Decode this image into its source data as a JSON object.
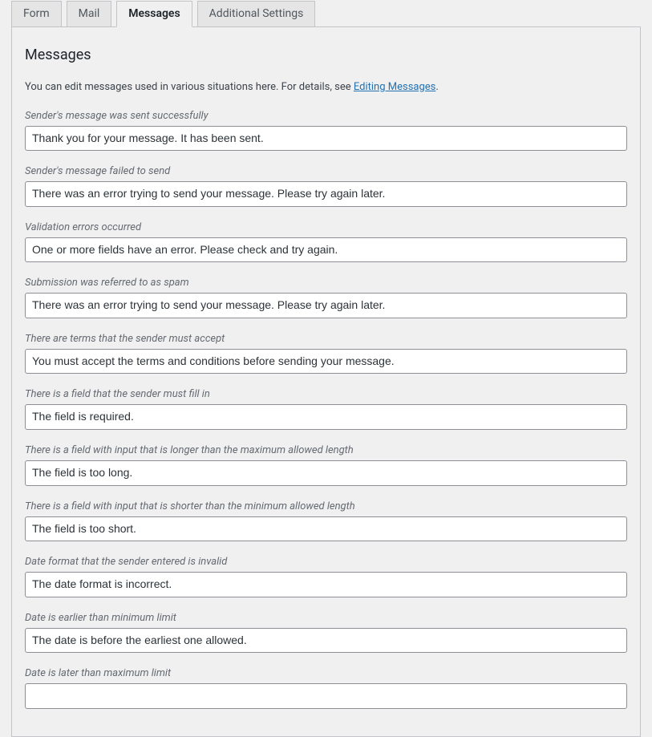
{
  "tabs": [
    {
      "label": "Form",
      "active": false
    },
    {
      "label": "Mail",
      "active": false
    },
    {
      "label": "Messages",
      "active": true
    },
    {
      "label": "Additional Settings",
      "active": false
    }
  ],
  "panel": {
    "title": "Messages",
    "intro_prefix": "You can edit messages used in various situations here. For details, see ",
    "intro_link": "Editing Messages",
    "intro_suffix": "."
  },
  "fields": [
    {
      "label": "Sender's message was sent successfully",
      "value": "Thank you for your message. It has been sent."
    },
    {
      "label": "Sender's message failed to send",
      "value": "There was an error trying to send your message. Please try again later."
    },
    {
      "label": "Validation errors occurred",
      "value": "One or more fields have an error. Please check and try again."
    },
    {
      "label": "Submission was referred to as spam",
      "value": "There was an error trying to send your message. Please try again later."
    },
    {
      "label": "There are terms that the sender must accept",
      "value": "You must accept the terms and conditions before sending your message."
    },
    {
      "label": "There is a field that the sender must fill in",
      "value": "The field is required."
    },
    {
      "label": "There is a field with input that is longer than the maximum allowed length",
      "value": "The field is too long."
    },
    {
      "label": "There is a field with input that is shorter than the minimum allowed length",
      "value": "The field is too short."
    },
    {
      "label": "Date format that the sender entered is invalid",
      "value": "The date format is incorrect."
    },
    {
      "label": "Date is earlier than minimum limit",
      "value": "The date is before the earliest one allowed."
    },
    {
      "label": "Date is later than maximum limit",
      "value": ""
    }
  ]
}
